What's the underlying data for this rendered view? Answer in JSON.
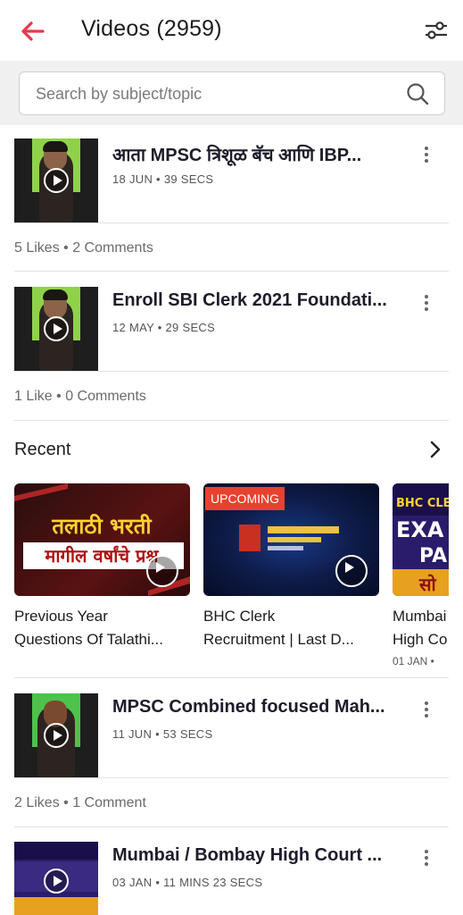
{
  "header": {
    "title": "Videos (2959)"
  },
  "search": {
    "placeholder": "Search by subject/topic"
  },
  "videos": [
    {
      "title": "आता MPSC त्रिशूळ बॅच आणि IBP...",
      "meta": "18 JUN • 39 SECS",
      "stats": "5 Likes • 2 Comments"
    },
    {
      "title": "Enroll SBI Clerk 2021 Foundati...",
      "meta": "12 MAY • 29 SECS",
      "stats": "1 Like • 0 Comments"
    },
    {
      "title": "MPSC Combined focused Mah...",
      "meta": "11 JUN • 53 SECS",
      "stats": "2 Likes • 1 Comment"
    },
    {
      "title": "Mumbai / Bombay High Court ...",
      "meta": "03 JAN • 11 MINS 23 SECS",
      "stats": ""
    }
  ],
  "recent": {
    "heading": "Recent",
    "cards": [
      {
        "line1": "Previous Year",
        "line2": "Questions Of Talathi...",
        "thumb_text1": "तलाठी भरती",
        "thumb_text2": "मागील वर्षांचे प्रश्न",
        "meta": ""
      },
      {
        "line1": "BHC Clerk",
        "line2": "Recruitment | Last D...",
        "badge": "UPCOMING",
        "meta": ""
      },
      {
        "line1": "Mumbai",
        "line2": "High Co",
        "thumb_text1": "BHC CLER",
        "thumb_text2": "EXA",
        "thumb_text3": "PA",
        "thumb_text4": "सो",
        "meta": "01 JAN •"
      }
    ]
  },
  "colors": {
    "accent": "#e8384f",
    "text": "#1c1c1c",
    "muted": "#6a6a6a"
  },
  "icons": [
    "back-arrow-icon",
    "filter-icon",
    "search-icon",
    "play-icon",
    "more-vert-icon",
    "chevron-right-icon"
  ]
}
